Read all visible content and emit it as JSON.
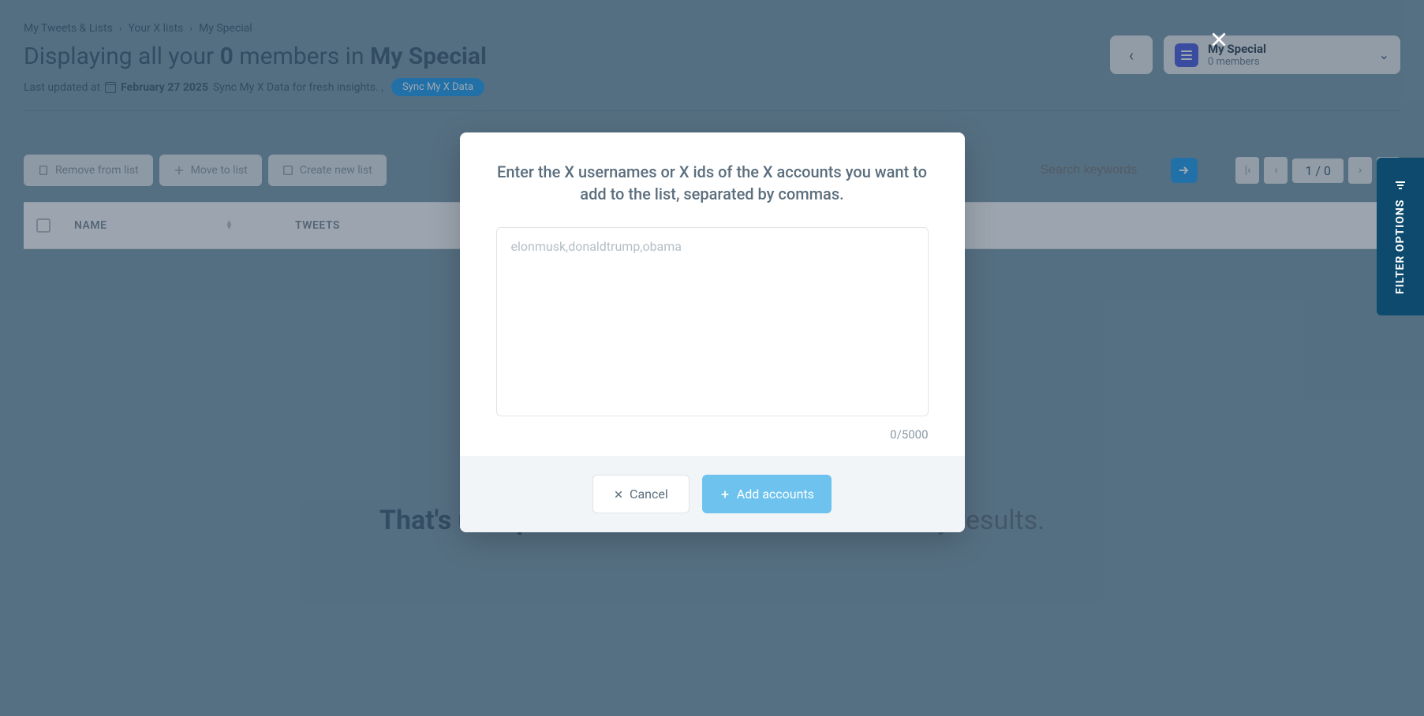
{
  "breadcrumb": {
    "item1": "My Tweets & Lists",
    "item2": "Your X lists",
    "item3": "My Special"
  },
  "heading": {
    "prefix": "Displaying all your ",
    "count": "0",
    "mid": " members in ",
    "listname": "My Special"
  },
  "subline": {
    "prefix": "Last updated at ",
    "date": "February 27 2025",
    "suffix": " Sync My X Data for fresh insights. ,",
    "sync_button": "Sync My X Data"
  },
  "list_selector": {
    "name": "My Special",
    "sub": "0 members"
  },
  "toolbar": {
    "remove": "Remove from list",
    "move": "Move to list",
    "create": "Create new list",
    "search_placeholder": "Search keywords",
    "page_display": "1 / 0"
  },
  "table": {
    "col_name": "NAME",
    "col_tweets": "TWEETS"
  },
  "empty": {
    "bold": "That's unexpected!",
    "rest": " Your search didn't return any results."
  },
  "filter_tab": "FILTER OPTIONS",
  "modal": {
    "title": "Enter the X usernames or X ids of the X accounts you want to add to the list, separated by commas.",
    "placeholder": "elonmusk,donaldtrump,obama",
    "charcount": "0/5000",
    "cancel": "Cancel",
    "add": "Add accounts"
  }
}
